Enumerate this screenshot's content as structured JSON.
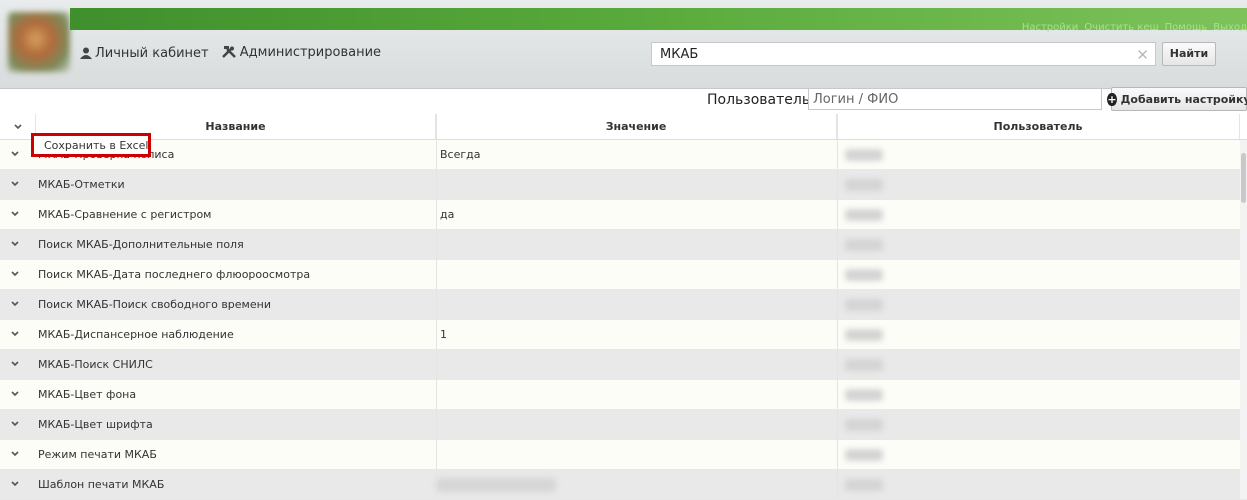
{
  "header": {
    "links": [
      "Настройки",
      "Очистить кеш",
      "Помощь",
      "Выход"
    ],
    "nav": [
      {
        "label": "Личный кабинет",
        "icon": "user-icon"
      },
      {
        "label": "Администрирование",
        "icon": "tools-icon"
      }
    ],
    "search": {
      "value": "МКАБ",
      "button": "Найти"
    }
  },
  "filter": {
    "user_label": "Пользователь:",
    "user_placeholder": "Логин / ФИО",
    "add_button": "Добавить настройку"
  },
  "table": {
    "columns": [
      "Название",
      "Значение",
      "Пользователь"
    ],
    "rows": [
      {
        "name": "МКАБ-Проверка полиса",
        "value": "Всегда"
      },
      {
        "name": "МКАБ-Отметки",
        "value": ""
      },
      {
        "name": "МКАБ-Сравнение с регистром",
        "value": "да"
      },
      {
        "name": "Поиск МКАБ-Дополнительные поля",
        "value": ""
      },
      {
        "name": "Поиск МКАБ-Дата последнего флюороосмотра",
        "value": ""
      },
      {
        "name": "Поиск МКАБ-Поиск свободного времени",
        "value": ""
      },
      {
        "name": "МКАБ-Диспансерное наблюдение",
        "value": "1"
      },
      {
        "name": "МКАБ-Поиск СНИЛС",
        "value": ""
      },
      {
        "name": "МКАБ-Цвет фона",
        "value": ""
      },
      {
        "name": "МКАБ-Цвет шрифта",
        "value": ""
      },
      {
        "name": "Режим печати МКАБ",
        "value": ""
      },
      {
        "name": "Шаблон печати МКАБ",
        "value": ""
      }
    ]
  },
  "context_menu": {
    "save_excel": "Сохранить в Excel"
  },
  "colors": {
    "accent_green": "#5aab3c",
    "highlight_red": "#cc0000"
  }
}
